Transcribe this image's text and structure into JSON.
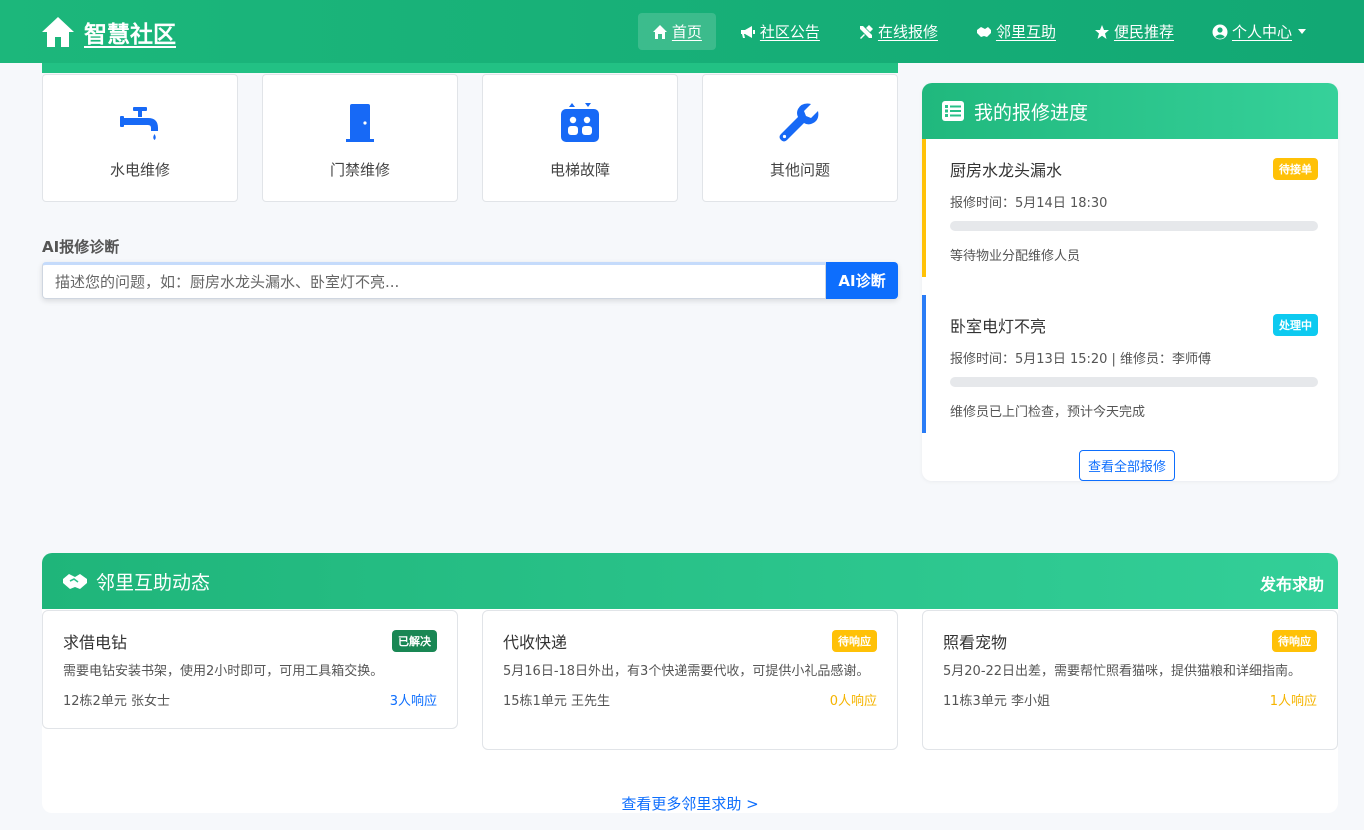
{
  "brand": {
    "title": "智慧社区"
  },
  "nav": {
    "items": [
      {
        "label": "首页"
      },
      {
        "label": "社区公告"
      },
      {
        "label": "在线报修"
      },
      {
        "label": "邻里互助"
      },
      {
        "label": "便民推荐"
      },
      {
        "label": "个人中心"
      }
    ]
  },
  "services": [
    {
      "label": "水电维修",
      "icon": "faucet-icon"
    },
    {
      "label": "门禁维修",
      "icon": "door-icon"
    },
    {
      "label": "电梯故障",
      "icon": "elevator-icon"
    },
    {
      "label": "其他问题",
      "icon": "wrench-icon"
    }
  ],
  "ai": {
    "label": "AI报修诊断",
    "placeholder": "描述您的问题，如：厨房水龙头漏水、卧室灯不亮...",
    "button": "AI诊断"
  },
  "repair": {
    "title": "我的报修进度",
    "items": [
      {
        "title": "厨房水龙头漏水",
        "status": "待接单",
        "time": "报修时间：5月14日 18:30",
        "progress": 0,
        "note": "等待物业分配维修人员"
      },
      {
        "title": "卧室电灯不亮",
        "status": "处理中",
        "time": "报修时间：5月13日 15:20 | 维修员：李师傅",
        "progress": 0,
        "note": "维修员已上门检查，预计今天完成"
      }
    ],
    "view_all": "查看全部报修"
  },
  "help": {
    "title": "邻里互助动态",
    "publish": "发布求助",
    "cards": [
      {
        "title": "求借电钻",
        "status": "已解决",
        "desc": "需要电钻安装书架，使用2小时即可，可用工具箱交换。",
        "location": "12栋2单元 张女士",
        "responses": "3人响应"
      },
      {
        "title": "代收快递",
        "status": "待响应",
        "desc": "5月16日-18日外出，有3个快递需要代收，可提供小礼品感谢。",
        "location": "15栋1单元 王先生",
        "responses": "0人响应"
      },
      {
        "title": "照看宠物",
        "status": "待响应",
        "desc": "5月20-22日出差，需要帮忙照看猫咪，提供猫粮和详细指南。",
        "location": "11栋3单元 李小姐",
        "responses": "1人响应"
      }
    ],
    "more": "查看更多邻里求助 >"
  },
  "colors": {
    "primary": "#0d6efd",
    "green": "#1cb77b",
    "warning": "#ffc107",
    "info": "#0dcaf0",
    "success": "#198754"
  }
}
